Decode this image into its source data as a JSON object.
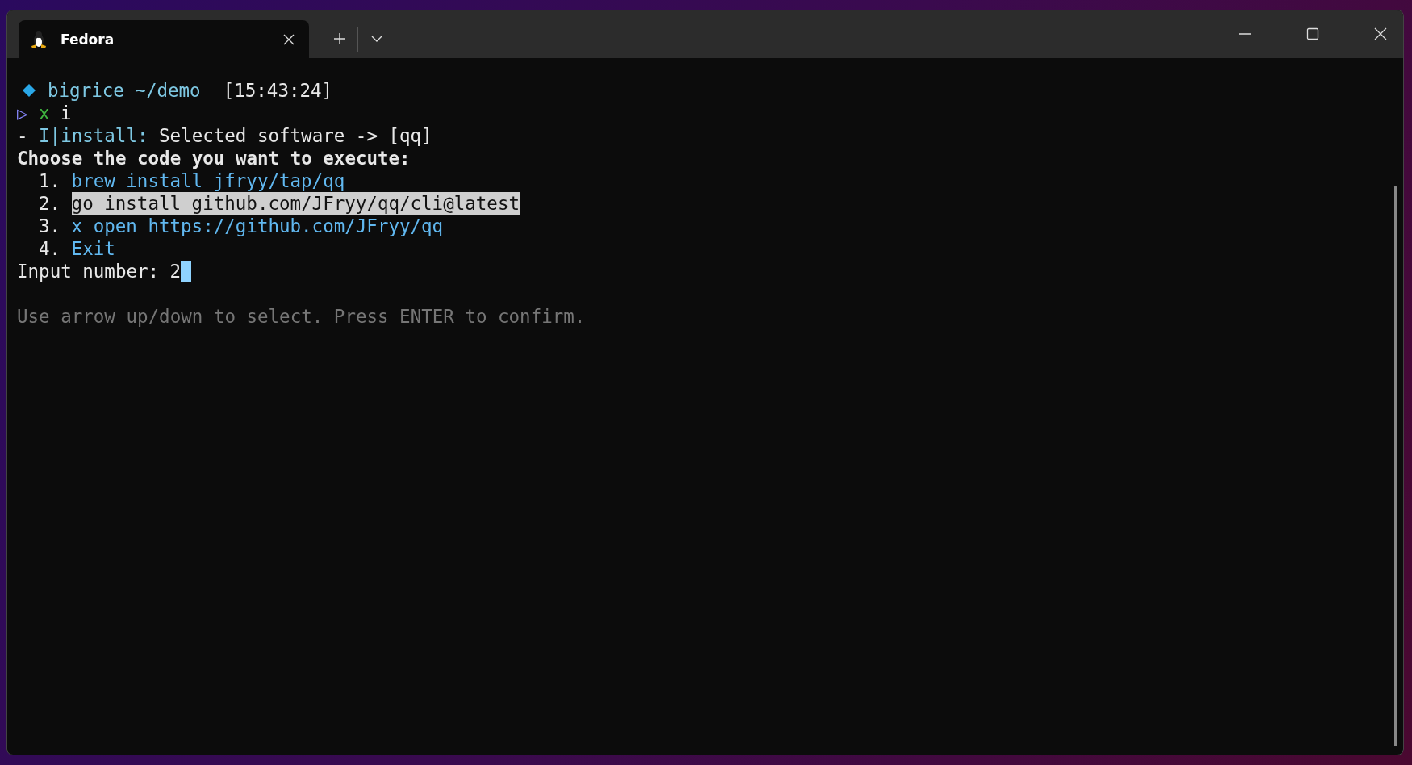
{
  "tabs": [
    {
      "title": "Fedora",
      "selected": true
    }
  ],
  "terminal": {
    "prompt": {
      "user_dir": "bigrice ~/demo",
      "time": "[15:43:24]"
    },
    "command": {
      "symbol": "▷",
      "program": "x",
      "args": "i"
    },
    "status": {
      "prefix": "-",
      "tag": "I|install:",
      "message": "Selected software -> [qq]"
    },
    "question": "Choose the code you want to execute:",
    "options": [
      {
        "number": "1.",
        "code": "brew install jfryy/tap/qq",
        "selected": false
      },
      {
        "number": "2.",
        "code": "go install github.com/JFryy/qq/cli@latest",
        "selected": true
      },
      {
        "number": "3.",
        "code": "x open https://github.com/JFryy/qq",
        "selected": false
      },
      {
        "number": "4.",
        "code": "Exit",
        "selected": false
      }
    ],
    "input": {
      "label": "Input number:",
      "value": "2"
    },
    "hint": "Use arrow up/down to select. Press ENTER to confirm."
  }
}
